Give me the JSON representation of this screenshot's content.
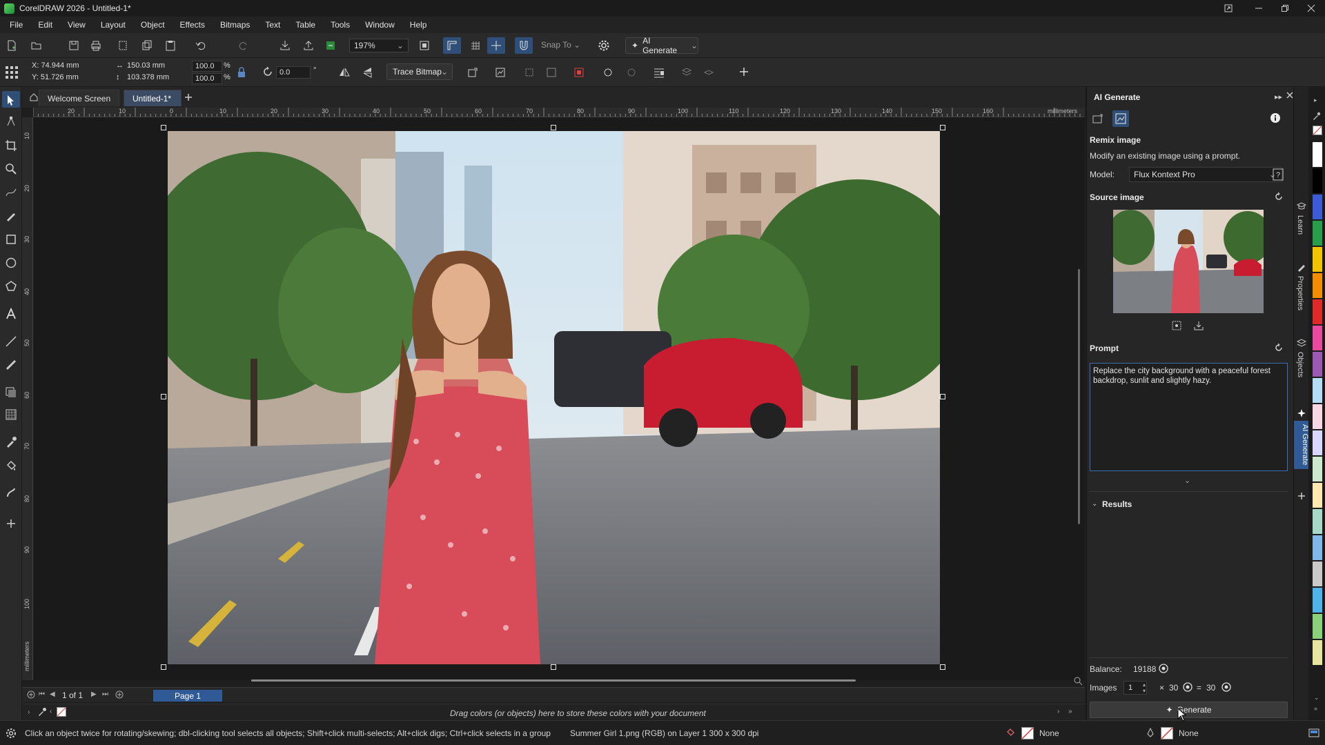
{
  "window": {
    "title": "CorelDRAW 2026 - Untitled-1*"
  },
  "menu": [
    "File",
    "Edit",
    "View",
    "Layout",
    "Object",
    "Effects",
    "Bitmaps",
    "Text",
    "Table",
    "Tools",
    "Window",
    "Help"
  ],
  "toolbar": {
    "zoom": "197%",
    "snap_to": "Snap To",
    "ai_generate": "AI Generate"
  },
  "propbar": {
    "x": "X: 74.944 mm",
    "y": "Y: 51.726 mm",
    "width": "150.03 mm",
    "height": "103.378 mm",
    "scale_w": "100.0",
    "scale_h": "100.0",
    "pct": "%",
    "rotation": "0.0",
    "deg": "°",
    "trace_bitmap": "Trace Bitmap"
  },
  "tabs": {
    "welcome": "Welcome Screen",
    "document": "Untitled-1*"
  },
  "ruler": {
    "h_marks": [
      "20",
      "10",
      "0",
      "10",
      "20",
      "30",
      "40",
      "50",
      "60",
      "70",
      "80",
      "90",
      "100",
      "110",
      "120",
      "130",
      "140",
      "150",
      "160"
    ],
    "unit": "millimeters",
    "v_marks": [
      "10",
      "20",
      "30",
      "40",
      "50",
      "60",
      "70",
      "80",
      "90",
      "100"
    ]
  },
  "page_nav": {
    "position": "1 of 1",
    "page_tab": "Page 1"
  },
  "color_bar": {
    "hint": "Drag colors (or objects) here to store these colors with your document"
  },
  "status": {
    "hint": "Click an object twice for rotating/skewing; dbl-clicking tool selects all objects; Shift+click multi-selects; Alt+click digs; Ctrl+click selects in a group",
    "object_info": "Summer Girl 1.png (RGB) on Layer 1 300 x 300 dpi",
    "fill": "None",
    "outline": "None"
  },
  "ai_panel": {
    "title": "AI Generate",
    "section": "Remix image",
    "description": "Modify an existing image using a prompt.",
    "model_label": "Model:",
    "model_value": "Flux Kontext Pro",
    "source_label": "Source image",
    "prompt_label": "Prompt",
    "prompt_text": "Replace the city background with a peaceful forest backdrop, sunlit and slightly hazy.",
    "results_label": "Results",
    "balance_label": "Balance:",
    "balance_value": "19188",
    "images_label": "Images",
    "images_count": "1",
    "times": "×",
    "cost_each": "30",
    "equals": "=",
    "cost_total": "30",
    "generate": "Generate"
  },
  "docker_tabs": [
    "Learn",
    "Properties",
    "Objects",
    "AI Generate"
  ],
  "palette": [
    "#ffffff",
    "#000000",
    "#3c5bd6",
    "#2a9d4a",
    "#f2c300",
    "#f28c00",
    "#e02a2a",
    "#e84aa0",
    "#9b59b6",
    "#b4dcf5",
    "#f7d7e6",
    "#d8d8ff",
    "#cde9cd",
    "#ffe9b0",
    "#a8d8c8",
    "#7fb8e8",
    "#c9c9c9",
    "#4fb3e8",
    "#8bd17c",
    "#e6e6a0"
  ]
}
